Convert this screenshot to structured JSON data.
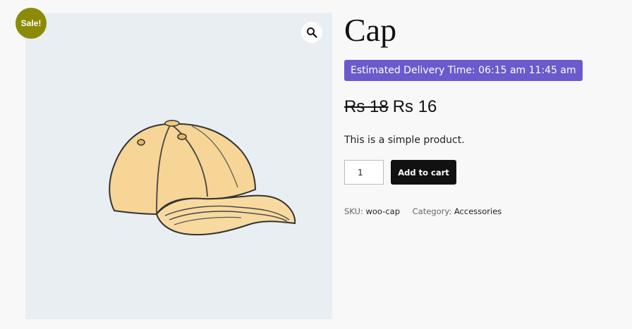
{
  "sale_badge": "Sale!",
  "gallery": {
    "zoom_icon": "magnifier-icon",
    "image": "baseball-cap-illustration"
  },
  "product": {
    "title": "Cap",
    "delivery_notice": "Estimated Delivery Time: 06:15 am 11:45 am",
    "price_regular": "Rs 18",
    "price_sale": "Rs 16",
    "short_description": "This is a simple product.",
    "quantity": "1",
    "add_to_cart_label": "Add to cart",
    "sku_label": "SKU:",
    "sku_value": "woo-cap",
    "category_label": "Category:",
    "category_value": "Accessories"
  },
  "colors": {
    "sale_badge": "#8b8b08",
    "delivery_bg": "#6a5acd",
    "add_to_cart_bg": "#111111",
    "gallery_bg": "#e9eef3"
  }
}
